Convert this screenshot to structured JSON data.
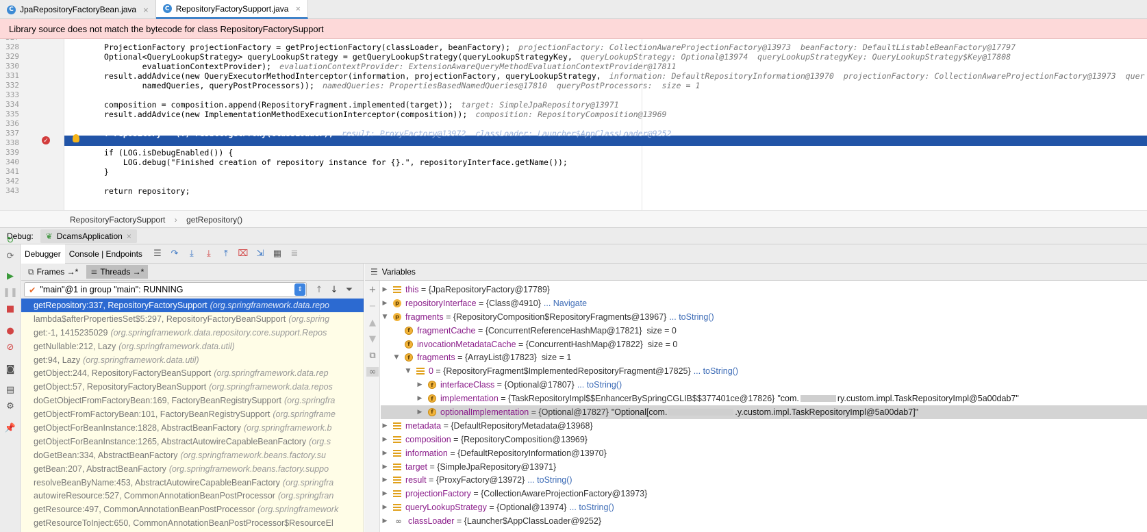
{
  "tabs": [
    {
      "label": "JpaRepositoryFactoryBean.java"
    },
    {
      "label": "RepositoryFactorySupport.java"
    }
  ],
  "warning": "Library source does not match the bytecode for class RepositoryFactorySupport",
  "editor": {
    "lines": [
      {
        "n": "327",
        "code": ""
      },
      {
        "n": "328",
        "code": "        ProjectionFactory projectionFactory = getProjectionFactory(classLoader, beanFactory);",
        "hint": "projectionFactory: CollectionAwareProjectionFactory@13973  beanFactory: DefaultListableBeanFactory@17797"
      },
      {
        "n": "329",
        "code": "        Optional<QueryLookupStrategy> queryLookupStrategy = getQueryLookupStrategy(queryLookupStrategyKey,",
        "hint": "queryLookupStrategy: Optional@13974  queryLookupStrategyKey: QueryLookupStrategy$Key@17808"
      },
      {
        "n": "330",
        "code": "                evaluationContextProvider);",
        "hint": "evaluationContextProvider: ExtensionAwareQueryMethodEvaluationContextProvider@17811"
      },
      {
        "n": "331",
        "code": "        result.addAdvice(new QueryExecutorMethodInterceptor(information, projectionFactory, queryLookupStrategy,",
        "hint": "information: DefaultRepositoryInformation@13970  projectionFactory: CollectionAwareProjectionFactory@13973  quer"
      },
      {
        "n": "332",
        "code": "                namedQueries, queryPostProcessors));",
        "hint": "namedQueries: PropertiesBasedNamedQueries@17810  queryPostProcessors:  size = 1"
      },
      {
        "n": "333",
        "code": ""
      },
      {
        "n": "334",
        "code": "        composition = composition.append(RepositoryFragment.implemented(target));",
        "hint": "target: SimpleJpaRepository@13971"
      },
      {
        "n": "335",
        "code": "        result.addAdvice(new ImplementationMethodExecutionInterceptor(composition));",
        "hint": "composition: RepositoryComposition@13969"
      },
      {
        "n": "336",
        "code": ""
      },
      {
        "n": "337",
        "code": "        T repository = (T) result.getProxy(classLoader);",
        "hint": "result: ProxyFactory@13972  classLoader: Launcher$AppClassLoader@9252"
      },
      {
        "n": "338",
        "code": ""
      },
      {
        "n": "339",
        "code": "        if (LOG.isDebugEnabled()) {"
      },
      {
        "n": "340",
        "code": "            LOG.debug(\"Finished creation of repository instance for {}.\", repositoryInterface.getName());"
      },
      {
        "n": "341",
        "code": "        }"
      },
      {
        "n": "342",
        "code": ""
      },
      {
        "n": "343",
        "code": "        return repository;"
      }
    ]
  },
  "breadcrumb": [
    "RepositoryFactorySupport",
    "getRepository()"
  ],
  "debug": {
    "label": "Debug:",
    "session": "DcamsApplication",
    "debugger_tab": "Debugger",
    "console_tab": "Console | Endpoints"
  },
  "frames_tab": "Frames →*",
  "threads_tab": "Threads →*",
  "variables_title": "Variables",
  "thread_combo": "\"main\"@1 in group \"main\": RUNNING",
  "frames": [
    {
      "m": "getRepository:337, RepositoryFactorySupport",
      "p": "(org.springframework.data.repo"
    },
    {
      "m": "lambda$afterPropertiesSet$5:297, RepositoryFactoryBeanSupport",
      "p": "(org.spring"
    },
    {
      "m": "get:-1, 1415235029",
      "p": "(org.springframework.data.repository.core.support.Repos"
    },
    {
      "m": "getNullable:212, Lazy",
      "p": "(org.springframework.data.util)"
    },
    {
      "m": "get:94, Lazy",
      "p": "(org.springframework.data.util)"
    },
    {
      "m": "getObject:244, RepositoryFactoryBeanSupport",
      "p": "(org.springframework.data.rep"
    },
    {
      "m": "getObject:57, RepositoryFactoryBeanSupport",
      "p": "(org.springframework.data.repos"
    },
    {
      "m": "doGetObjectFromFactoryBean:169, FactoryBeanRegistrySupport",
      "p": "(org.springfra"
    },
    {
      "m": "getObjectFromFactoryBean:101, FactoryBeanRegistrySupport",
      "p": "(org.springframe"
    },
    {
      "m": "getObjectForBeanInstance:1828, AbstractBeanFactory",
      "p": "(org.springframework.b"
    },
    {
      "m": "getObjectForBeanInstance:1265, AbstractAutowireCapableBeanFactory",
      "p": "(org.s"
    },
    {
      "m": "doGetBean:334, AbstractBeanFactory",
      "p": "(org.springframework.beans.factory.su"
    },
    {
      "m": "getBean:207, AbstractBeanFactory",
      "p": "(org.springframework.beans.factory.suppo"
    },
    {
      "m": "resolveBeanByName:453, AbstractAutowireCapableBeanFactory",
      "p": "(org.springfra"
    },
    {
      "m": "autowireResource:527, CommonAnnotationBeanPostProcessor",
      "p": "(org.springfran"
    },
    {
      "m": "getResource:497, CommonAnnotationBeanPostProcessor",
      "p": "(org.springframework"
    },
    {
      "m": "getResourceToInject:650, CommonAnnotationBeanPostProcessor$ResourceEl",
      "p": ""
    }
  ],
  "variables": [
    {
      "tri": "▶",
      "icon": "lines",
      "name": "this",
      "val": " = {JpaRepositoryFactory@17789}"
    },
    {
      "tri": "▶",
      "icon": "p",
      "name": "repositoryInterface",
      "val": " = {Class@4910}",
      "link": "... Navigate"
    },
    {
      "tri": "▼",
      "icon": "p",
      "name": "fragments",
      "val": " = {RepositoryComposition$RepositoryFragments@13967}",
      "link": "... toString()"
    },
    {
      "tri": "",
      "icon": "f",
      "name": "fragmentCache",
      "val": " = {ConcurrentReferenceHashMap@17821}  size = 0",
      "indent": 1
    },
    {
      "tri": "",
      "icon": "f",
      "name": "invocationMetadataCache",
      "val": " = {ConcurrentHashMap@17822}  size = 0",
      "indent": 1
    },
    {
      "tri": "▼",
      "icon": "f",
      "name": "fragments",
      "val": " = {ArrayList@17823}  size = 1",
      "indent": 1
    },
    {
      "tri": "▼",
      "icon": "lines",
      "name": "0",
      "val": " = {RepositoryFragment$ImplementedRepositoryFragment@17825}",
      "link": "... toString()",
      "indent": 2
    },
    {
      "tri": "▶",
      "icon": "f",
      "name": "interfaceClass",
      "val": " = {Optional@17807}",
      "link": "... toString()",
      "indent": 3
    },
    {
      "tri": "▶",
      "icon": "f",
      "name": "implementation",
      "val": " = {TaskRepositoryImpl$$EnhancerBySpringCGLIB$$377401ce@17826}",
      "str": "\"com.",
      "redact": 52,
      "str2": "ry.custom.impl.TaskRepositoryImpl@5a00dab7\"",
      "indent": 3
    },
    {
      "tri": "▶",
      "icon": "f",
      "name": "optionalImplementation",
      "val": " = {Optional@17827}",
      "str": "\"Optional[com.",
      "redact": 95,
      "str2": ".y.custom.impl.TaskRepositoryImpl@5a00dab7]\"",
      "indent": 3,
      "sel": true
    },
    {
      "tri": "▶",
      "icon": "lines",
      "name": "metadata",
      "val": " = {DefaultRepositoryMetadata@13968}"
    },
    {
      "tri": "▶",
      "icon": "lines",
      "name": "composition",
      "val": " = {RepositoryComposition@13969}"
    },
    {
      "tri": "▶",
      "icon": "lines",
      "name": "information",
      "val": " = {DefaultRepositoryInformation@13970}"
    },
    {
      "tri": "▶",
      "icon": "lines",
      "name": "target",
      "val": " = {SimpleJpaRepository@13971}"
    },
    {
      "tri": "▶",
      "icon": "lines",
      "name": "result",
      "val": " = {ProxyFactory@13972}",
      "link": "... toString()"
    },
    {
      "tri": "▶",
      "icon": "lines",
      "name": "projectionFactory",
      "val": " = {CollectionAwareProjectionFactory@13973}"
    },
    {
      "tri": "▶",
      "icon": "lines",
      "name": "queryLookupStrategy",
      "val": " = {Optional@13974}",
      "link": "... toString()"
    },
    {
      "tri": "▶",
      "icon": "oo",
      "name": "classLoader",
      "val": " = {Launcher$AppClassLoader@9252}"
    }
  ]
}
